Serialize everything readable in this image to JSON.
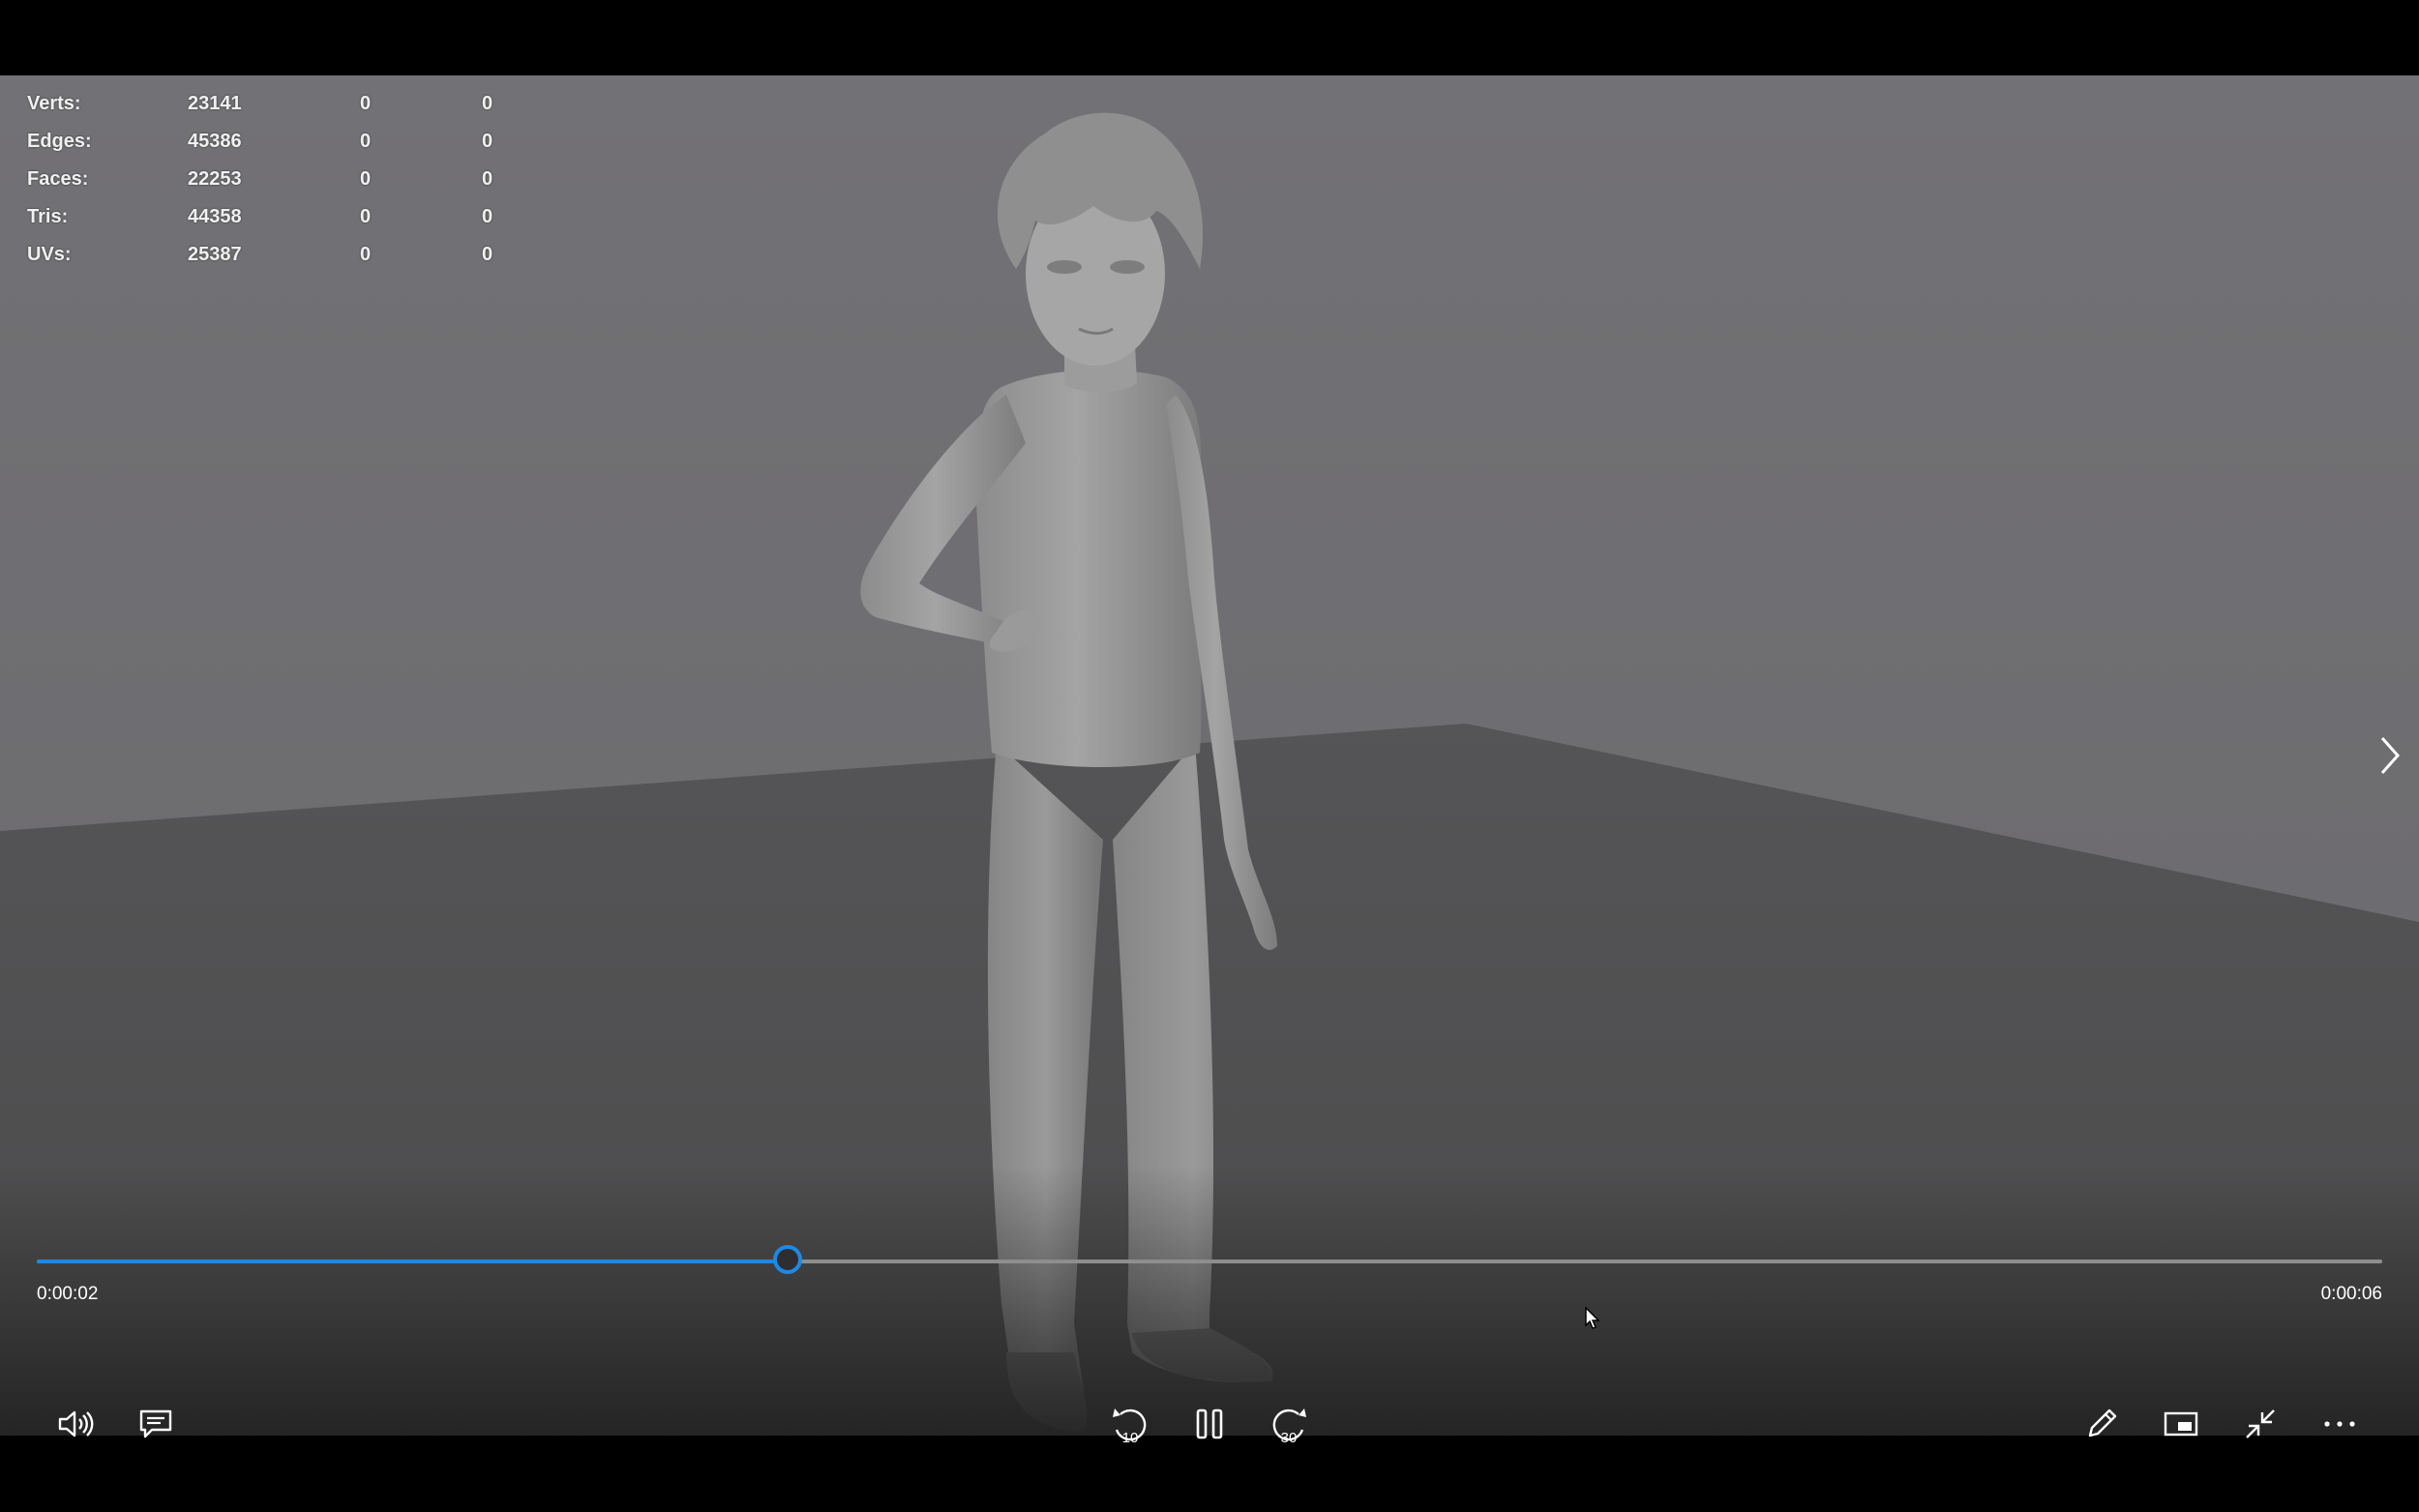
{
  "hud": {
    "rows": [
      {
        "label": "Verts:",
        "total": "23141",
        "selected": "0",
        "highlighted": "0"
      },
      {
        "label": "Edges:",
        "total": "45386",
        "selected": "0",
        "highlighted": "0"
      },
      {
        "label": "Faces:",
        "total": "22253",
        "selected": "0",
        "highlighted": "0"
      },
      {
        "label": "Tris:",
        "total": "44358",
        "selected": "0",
        "highlighted": "0"
      },
      {
        "label": "UVs:",
        "total": "25387",
        "selected": "0",
        "highlighted": "0"
      }
    ]
  },
  "player": {
    "current_time": "0:00:02",
    "total_time": "0:00:06",
    "progress_fraction": 0.32,
    "skip_back_label": "10",
    "skip_forward_label": "30",
    "accent_color": "#1e88e5"
  },
  "icons": {
    "volume": "volume-icon",
    "captions": "captions-icon",
    "skip_back": "skip-back-10-icon",
    "pause": "pause-icon",
    "skip_forward": "skip-forward-30-icon",
    "edit": "pencil-icon",
    "mini_view": "mini-view-icon",
    "exit_fullscreen": "exit-fullscreen-icon",
    "more": "more-icon",
    "next": "chevron-right-icon"
  }
}
